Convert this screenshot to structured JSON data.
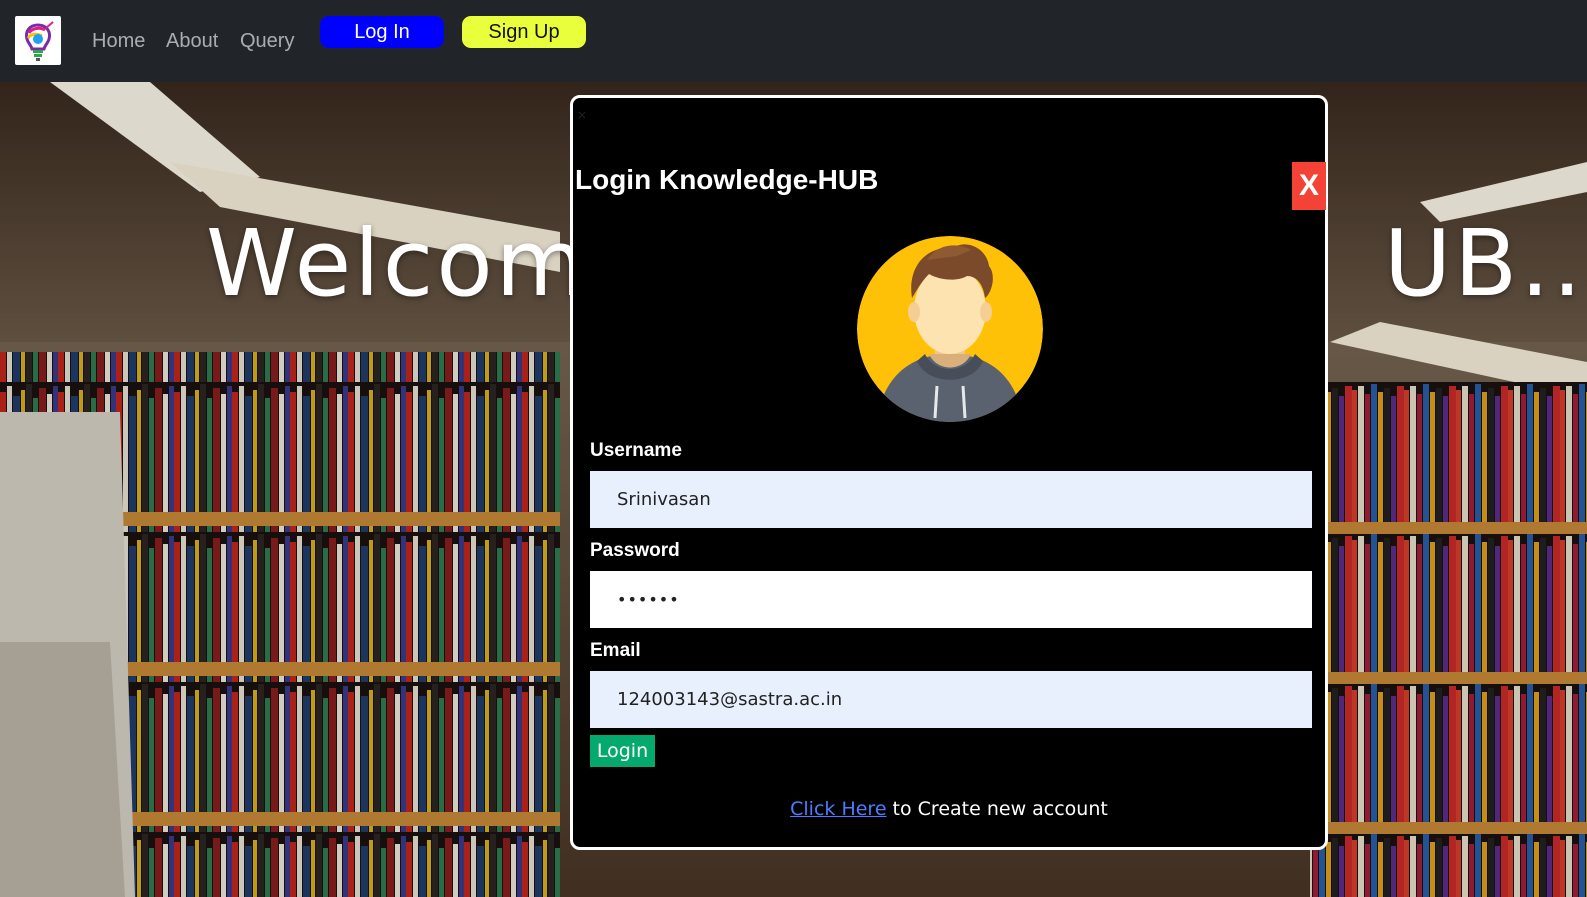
{
  "navbar": {
    "links": {
      "home": "Home",
      "about": "About",
      "query": "Query"
    },
    "login_button": "Log In",
    "signup_button": "Sign Up",
    "colors": {
      "bg": "#212529",
      "login": "#0000ff",
      "signup": "#eaff3c"
    }
  },
  "hero": {
    "welcome_left": "Welcome",
    "welcome_right": "UB......"
  },
  "modal": {
    "tiny_close": "×",
    "title": "Login Knowledge-HUB",
    "close_label": "X",
    "avatar_icon": "user-avatar-icon",
    "username_label": "Username",
    "username_value": "Srinivasan",
    "password_label": "Password",
    "password_value": "••••••",
    "email_label": "Email",
    "email_value": "124003143@sastra.ac.in",
    "login_button": "Login",
    "create_link": "Click Here",
    "create_text": " to Create new account",
    "colors": {
      "close": "#f44336",
      "login": "#04aa6d",
      "link": "#4a7dff",
      "autofill": "#e8f0fe"
    }
  }
}
